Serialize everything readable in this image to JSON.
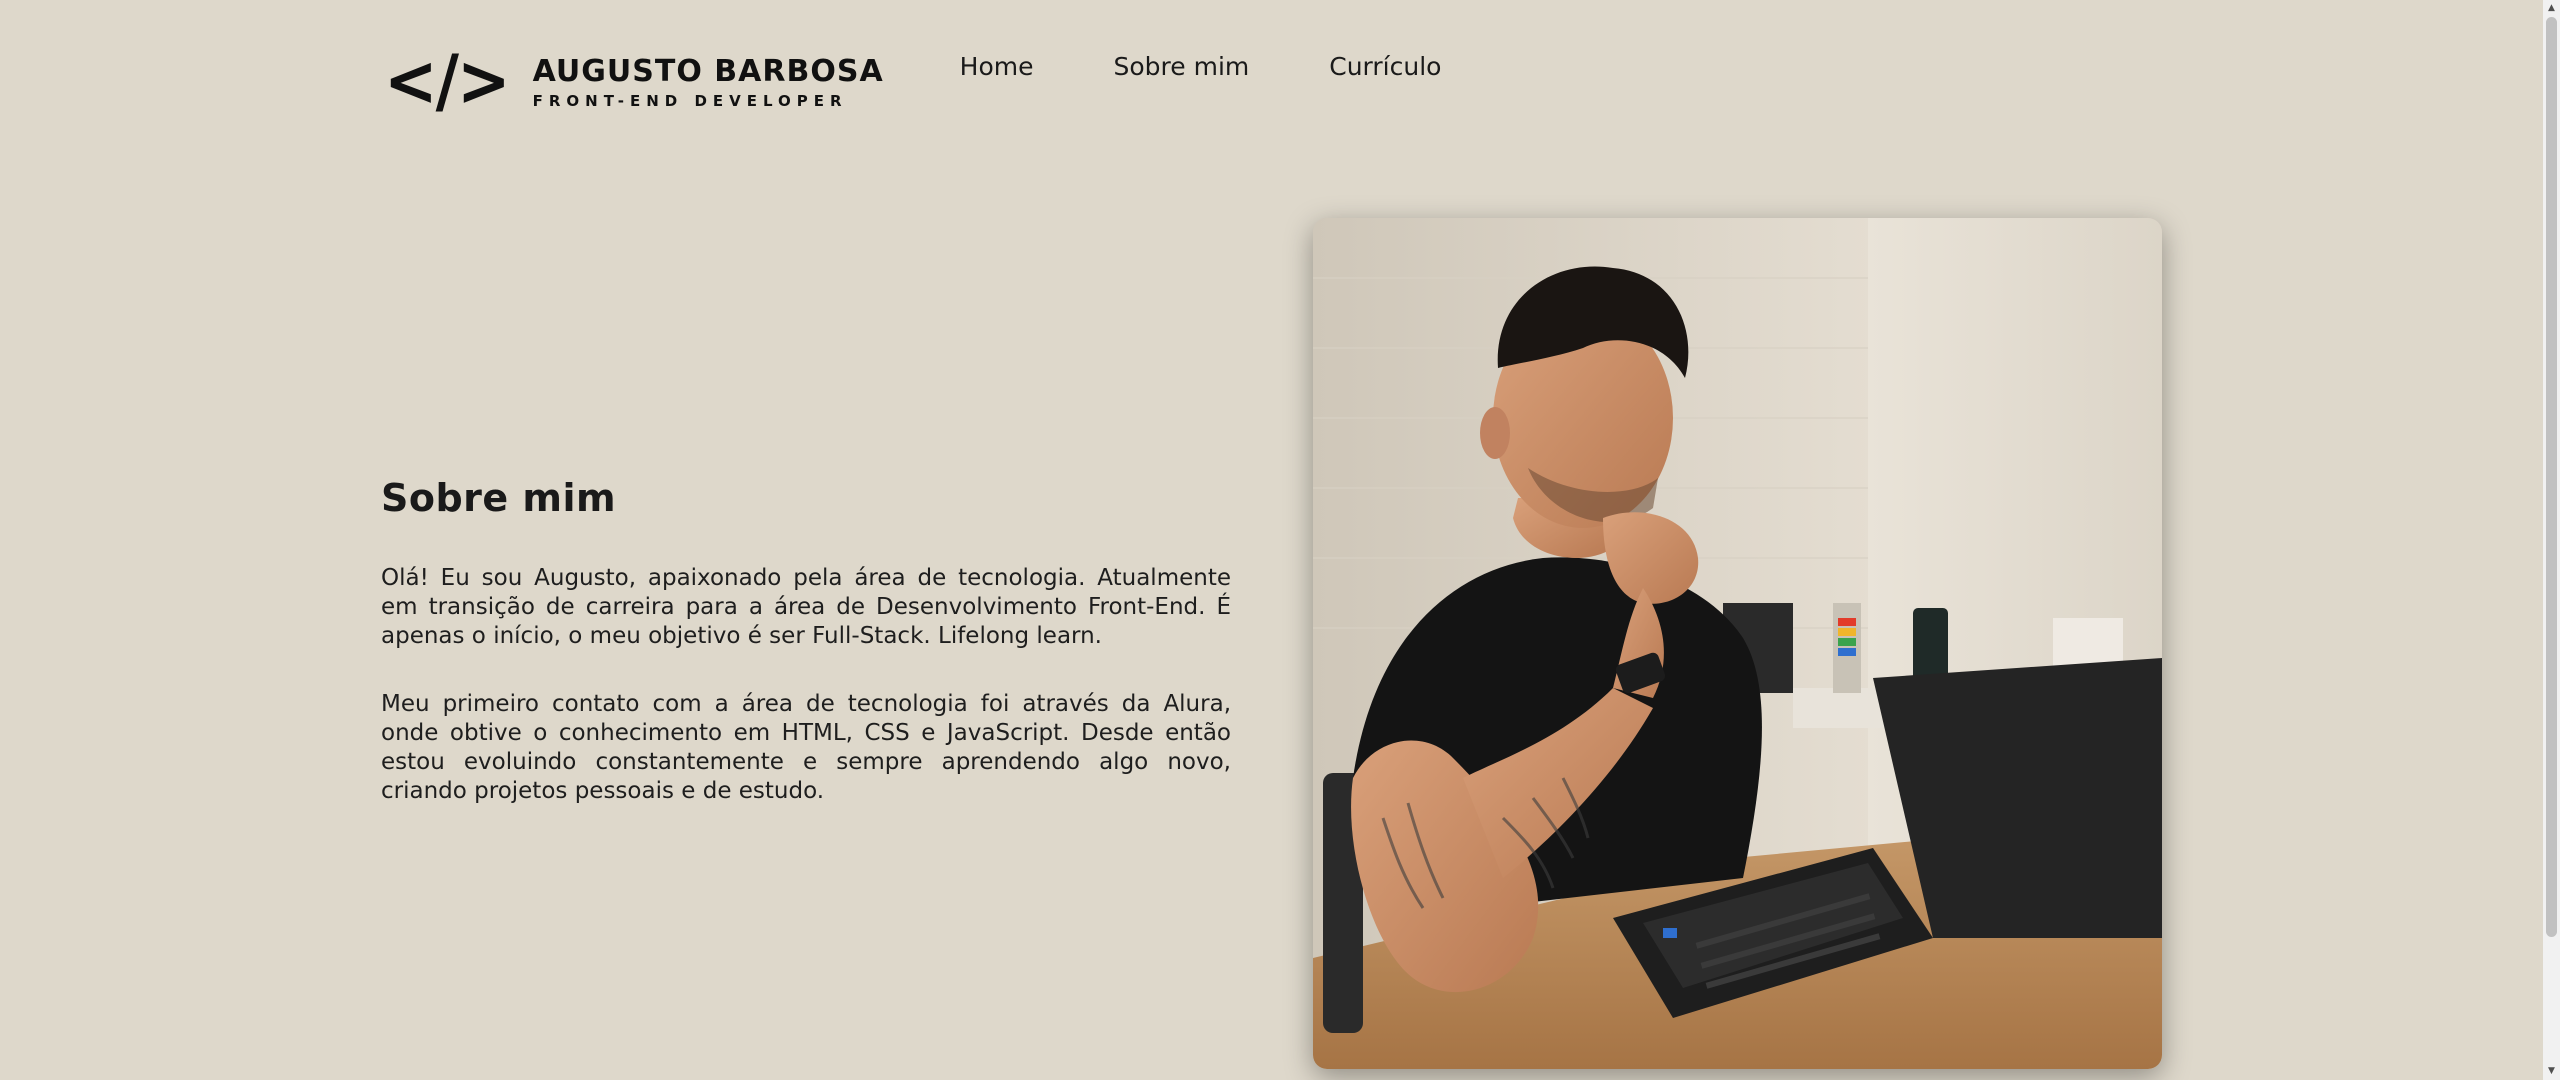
{
  "header": {
    "logo_mark": "</>",
    "name": "AUGUSTO BARBOSA",
    "role": "FRONT-END DEVELOPER"
  },
  "nav": {
    "items": [
      {
        "label": "Home"
      },
      {
        "label": "Sobre mim"
      },
      {
        "label": "Currículo"
      }
    ]
  },
  "about": {
    "title": "Sobre mim",
    "paragraphs": [
      "Olá! Eu sou Augusto, apaixonado pela área de tecnologia. Atualmente em transição de carreira para a área de Desenvolvimento Front-End. É apenas o início, o meu objetivo é ser Full-Stack. Lifelong learn.",
      "Meu primeiro contato com a área de tecnologia foi através da Alura, onde obtive o conhecimento em HTML, CSS e JavaScript. Desde então estou evoluindo constantemente e sempre aprendendo algo novo, criando projetos pessoais e de estudo."
    ]
  },
  "colors": {
    "background": "#ded8cb",
    "text": "#1a1a1a"
  },
  "icons": {
    "scroll_up": "triangle-up",
    "scroll_down": "triangle-down"
  }
}
